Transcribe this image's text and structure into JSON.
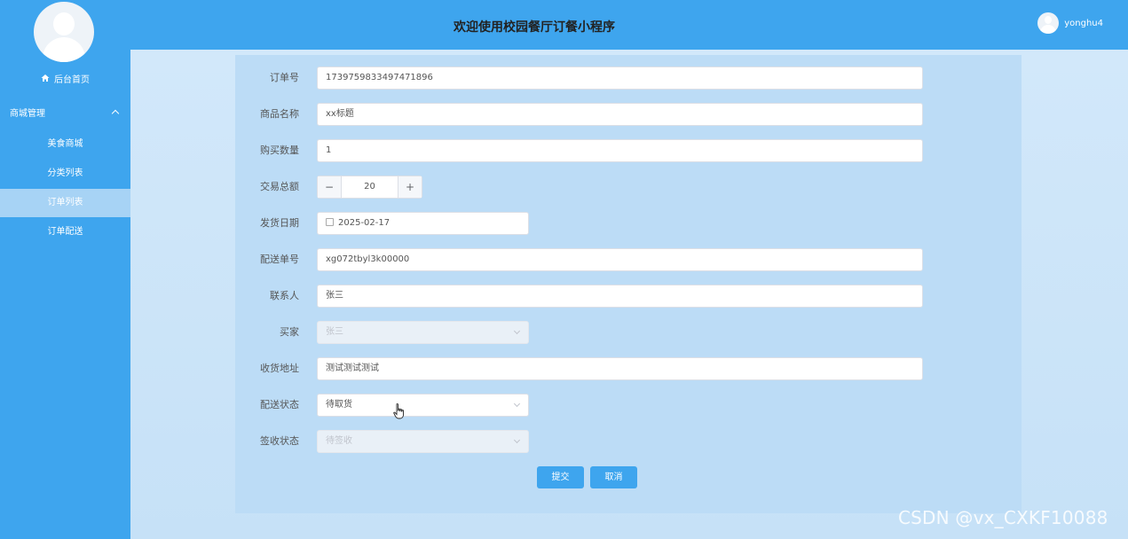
{
  "sidebar": {
    "home_label": "后台首页",
    "group_label": "商城管理",
    "items": [
      {
        "label": "美食商城"
      },
      {
        "label": "分类列表"
      },
      {
        "label": "订单列表"
      },
      {
        "label": "订单配送"
      }
    ]
  },
  "header": {
    "title": "欢迎使用校园餐厅订餐小程序",
    "username": "yonghu4"
  },
  "form": {
    "order_no": {
      "label": "订单号",
      "value": "1739759833497471896"
    },
    "product_name": {
      "label": "商品名称",
      "value": "xx标题"
    },
    "quantity": {
      "label": "购买数量",
      "value": "1"
    },
    "total": {
      "label": "交易总额",
      "value": "20",
      "minus": "−",
      "plus": "+"
    },
    "ship_date": {
      "label": "发货日期",
      "value": "2025-02-17"
    },
    "delivery_no": {
      "label": "配送单号",
      "value": "xg072tbyl3k00000"
    },
    "contact": {
      "label": "联系人",
      "value": "张三"
    },
    "buyer": {
      "label": "买家",
      "value": "张三"
    },
    "address": {
      "label": "收货地址",
      "value": "测试测试测试"
    },
    "delivery_status": {
      "label": "配送状态",
      "value": "待取货"
    },
    "sign_status": {
      "label": "签收状态",
      "value": "待签收"
    }
  },
  "buttons": {
    "submit": "提交",
    "cancel": "取消"
  },
  "watermark": "CSDN @vx_CXKF10088",
  "colors": {
    "accent": "#3ea5ee",
    "sidebar_active": "#a7d3f5",
    "background": "#cfe6f8"
  }
}
